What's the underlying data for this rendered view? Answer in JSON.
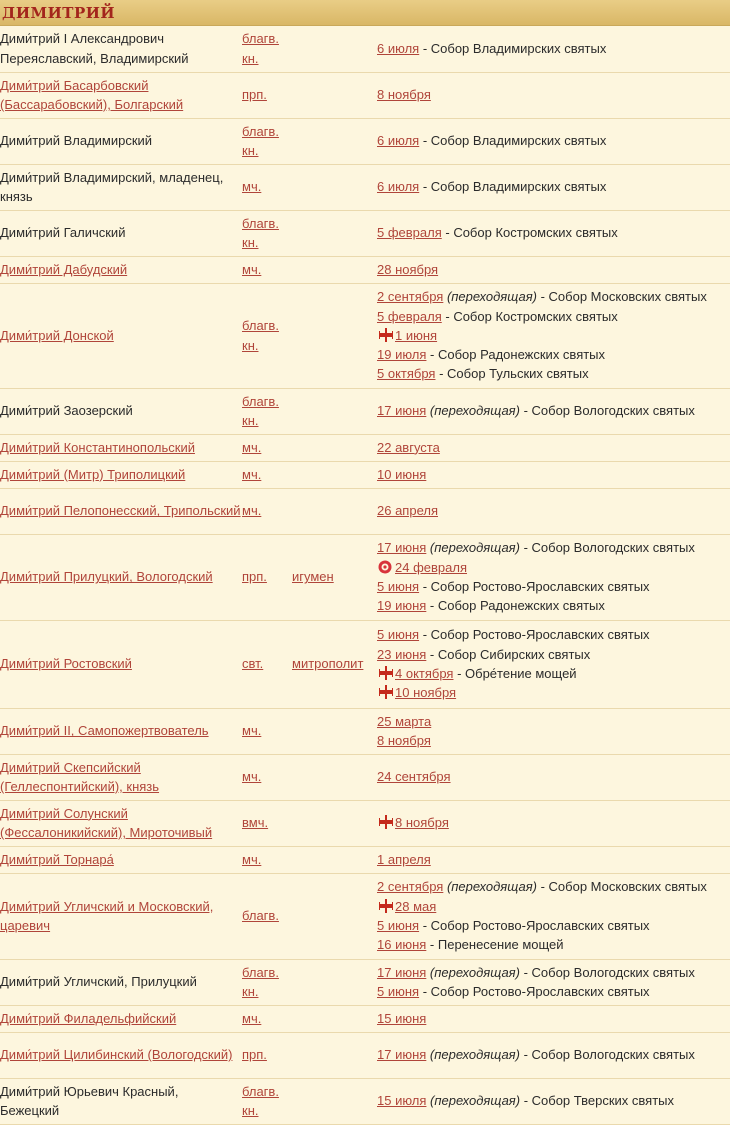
{
  "header": {
    "title": "ДИМИТРИЙ"
  },
  "rows": [
    {
      "h": 46,
      "name": "Дими́трий I Александрович Переяславский, Владимирский",
      "link": false,
      "rank": "благв. кн.",
      "role": "",
      "dates": [
        {
          "d": "6 июля",
          "t": " - Собор Владимирских святых"
        }
      ]
    },
    {
      "h": 46,
      "name": "Дими́трий Басарбовский (Бассарабовский), Болгарский",
      "link": true,
      "rank": "прп.",
      "role": "",
      "dates": [
        {
          "d": "8 ноября",
          "t": ""
        }
      ]
    },
    {
      "h": 46,
      "name": "Дими́трий Владимирский",
      "link": false,
      "rank": "благв. кн.",
      "role": "",
      "dates": [
        {
          "d": "6 июля",
          "t": " - Собор Владимирских святых"
        }
      ]
    },
    {
      "h": 46,
      "name": "Дими́трий Владимирский, младенец, князь",
      "link": false,
      "rank": "мч.",
      "role": "",
      "dates": [
        {
          "d": "6 июля",
          "t": " - Собор Владимирских святых"
        }
      ]
    },
    {
      "h": 46,
      "name": "Дими́трий Галичский",
      "link": false,
      "rank": "благв. кн.",
      "role": "",
      "dates": [
        {
          "d": "5 февраля",
          "t": " - Собор Костромских святых"
        }
      ]
    },
    {
      "h": 27,
      "name": "Дими́трий Дабудский",
      "link": true,
      "rank": "мч.",
      "role": "",
      "dates": [
        {
          "d": "28 ноября",
          "t": ""
        }
      ]
    },
    {
      "h": 105,
      "name": "Дими́трий Донской",
      "link": true,
      "rank": "благв. кн.",
      "role": "",
      "dates": [
        {
          "d": "2 сентября",
          "it": " (переходящая)",
          "t": " - Собор Московских святых"
        },
        {
          "d": "5 февраля",
          "t": " - Собор Костромских святых"
        },
        {
          "d": "1 июня",
          "t": "",
          "icon": "cross"
        },
        {
          "d": "19 июля",
          "t": " - Собор Радонежских святых"
        },
        {
          "d": "5 октября",
          "t": " - Собор Тульских святых"
        }
      ]
    },
    {
      "h": 46,
      "name": "Дими́трий Заозерский",
      "link": false,
      "rank": "благв. кн.",
      "role": "",
      "dates": [
        {
          "d": "17 июня",
          "it": " (переходящая)",
          "t": " - Собор Вологодских святых"
        }
      ]
    },
    {
      "h": 27,
      "name": "Дими́трий Константинопольский",
      "link": true,
      "rank": "мч.",
      "role": "",
      "dates": [
        {
          "d": "22 августа",
          "t": ""
        }
      ]
    },
    {
      "h": 27,
      "name": "Дими́трий (Митр) Триполицкий",
      "link": true,
      "rank": "мч.",
      "role": "",
      "dates": [
        {
          "d": "10 июня",
          "t": ""
        }
      ]
    },
    {
      "h": 46,
      "name": "Дими́трий Пелопонесский, Трипольский",
      "link": true,
      "rank": "мч.",
      "role": "",
      "dates": [
        {
          "d": "26 апреля",
          "t": ""
        }
      ]
    },
    {
      "h": 86,
      "name": "Дими́трий Прилуцкий, Вологодский",
      "link": true,
      "rank": "прп.",
      "role": "игумен",
      "dates": [
        {
          "d": "17 июня",
          "it": " (переходящая)",
          "t": " - Собор Вологодских святых"
        },
        {
          "d": "24 февраля",
          "t": "",
          "icon": "star"
        },
        {
          "d": "5 июня",
          "t": " - Собор Ростово-Ярославских святых"
        },
        {
          "d": "19 июня",
          "t": " - Собор Радонежских святых"
        }
      ]
    },
    {
      "h": 88,
      "name": "Дими́трий Ростовский",
      "link": true,
      "rank": "свт.",
      "role": "митрополит",
      "dates": [
        {
          "d": "5 июня",
          "t": " - Собор Ростово-Ярославских святых"
        },
        {
          "d": "23 июня",
          "t": " - Собор Сибирских святых"
        },
        {
          "d": "4 октября",
          "t": " - Обре́тение мощей",
          "icon": "cross"
        },
        {
          "d": "10 ноября",
          "t": "",
          "icon": "cross"
        }
      ]
    },
    {
      "h": 46,
      "name": "Дими́трий II, Самопожертвователь",
      "link": true,
      "rank": "мч.",
      "role": "",
      "dates": [
        {
          "d": "25 марта",
          "t": ""
        },
        {
          "d": "8 ноября",
          "t": ""
        }
      ]
    },
    {
      "h": 46,
      "name": "Дими́трий Скепсийский (Геллеспонтийский), князь",
      "link": true,
      "rank": "мч.",
      "role": "",
      "dates": [
        {
          "d": "24 сентября",
          "t": ""
        }
      ]
    },
    {
      "h": 46,
      "name": "Дими́трий Солунский (Фессалоникийский), Мироточивый",
      "link": true,
      "rank": "вмч.",
      "role": "",
      "dates": [
        {
          "d": "8 ноября",
          "t": "",
          "icon": "cross"
        }
      ]
    },
    {
      "h": 27,
      "name": "Дими́трий Торнара́",
      "link": true,
      "rank": "мч.",
      "role": "",
      "dates": [
        {
          "d": "1 апреля",
          "t": ""
        }
      ]
    },
    {
      "h": 86,
      "name": "Дими́трий Угличский и Московский, царевич",
      "link": true,
      "rank": "благв.",
      "role": "",
      "dates": [
        {
          "d": "2 сентября",
          "it": " (переходящая)",
          "t": " - Собор Московских святых"
        },
        {
          "d": "28 мая",
          "t": "",
          "icon": "cross"
        },
        {
          "d": "5 июня",
          "t": " - Собор Ростово-Ярославских святых"
        },
        {
          "d": "16 июня",
          "t": " - Перенесение мощей"
        }
      ]
    },
    {
      "h": 46,
      "name": "Дими́трий Угличский, Прилуцкий",
      "link": false,
      "rank": "благв. кн.",
      "role": "",
      "dates": [
        {
          "d": "17 июня",
          "it": " (переходящая)",
          "t": " - Собор Вологодских святых"
        },
        {
          "d": "5 июня",
          "t": " - Собор Ростово-Ярославских святых"
        }
      ]
    },
    {
      "h": 27,
      "name": "Дими́трий Филадельфийский",
      "link": true,
      "rank": "мч.",
      "role": "",
      "dates": [
        {
          "d": "15 июня",
          "t": ""
        }
      ]
    },
    {
      "h": 46,
      "name": "Дими́трий Цилибинский (Вологодский)",
      "link": true,
      "rank": "прп.",
      "role": "",
      "dates": [
        {
          "d": "17 июня",
          "it": " (переходящая)",
          "t": " - Собор Вологодских святых"
        }
      ]
    },
    {
      "h": 46,
      "name": "Дими́трий Юрьевич Красный, Бежецкий",
      "link": false,
      "rank": "благв. кн.",
      "role": "",
      "dates": [
        {
          "d": "15 июля",
          "it": " (переходящая)",
          "t": " - Собор Тверских святых"
        }
      ]
    }
  ],
  "colors": {
    "link": "#b0453a",
    "cross": "#c42a1c",
    "background": "#fdf6de"
  }
}
